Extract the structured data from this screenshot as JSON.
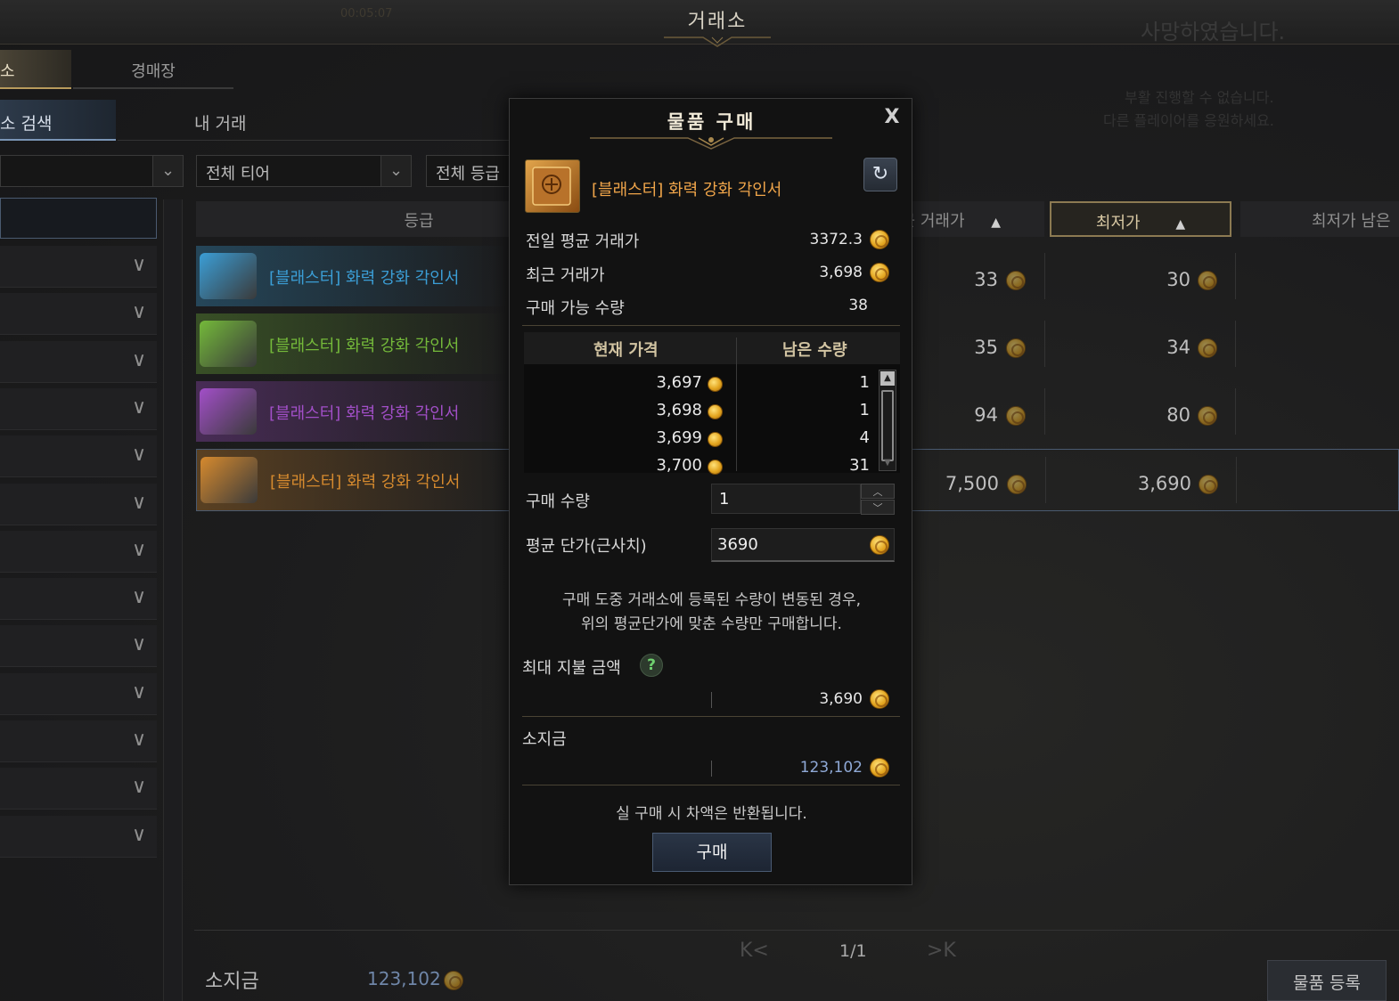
{
  "window": {
    "title": "거래소",
    "timer": "00:05:07",
    "death_title": "사망하였습니다.",
    "death_line1": "부활 진행할 수 없습니다.",
    "death_line2": "다른 플레이어를 응원하세요."
  },
  "main_tabs": [
    {
      "label": "소",
      "active": true
    },
    {
      "label": "경매장",
      "active": false
    }
  ],
  "sub_tabs": [
    {
      "label": "소 검색",
      "active": true
    },
    {
      "label": "내 거래",
      "active": false
    }
  ],
  "filters": {
    "tier": "전체 티어",
    "grade": "전체 등급"
  },
  "table": {
    "headers": {
      "grade": "등급",
      "recent": "최근 거래가",
      "lowest": "최저가",
      "remaining": "최저가 남은"
    },
    "rows": [
      {
        "name": "[블래스터] 화력 강화 각인서",
        "grade": "rare",
        "color": "#3b9ed6",
        "recent": "33",
        "lowest": "30"
      },
      {
        "name": "[블래스터] 화력 강화 각인서",
        "grade": "uncommon",
        "color": "#74b93a",
        "recent": "35",
        "lowest": "34"
      },
      {
        "name": "[블래스터] 화력 강화 각인서",
        "grade": "epic",
        "color": "#a24fc8",
        "recent": "94",
        "lowest": "80"
      },
      {
        "name": "[블래스터] 화력 강화 각인서",
        "grade": "legendary",
        "color": "#d68a2e",
        "recent": "7,500",
        "lowest": "3,690"
      }
    ]
  },
  "footer": {
    "gold_label": "소지금",
    "gold_value": "123,102",
    "pager": "1/1",
    "register_label": "물품 등록"
  },
  "modal": {
    "title": "물품 구매",
    "close": "X",
    "item_name": "[블래스터] 화력 강화 각인서",
    "item_color": "#f0a54a",
    "info": [
      {
        "label": "전일 평균 거래가",
        "value": "3372.3",
        "coin": true
      },
      {
        "label": "최근 거래가",
        "value": "3,698",
        "coin": true
      },
      {
        "label": "구매 가능 수량",
        "value": "38",
        "coin": false
      }
    ],
    "order_book": {
      "price_header": "현재 가격",
      "qty_header": "남은 수량",
      "rows": [
        {
          "price": "3,697",
          "qty": "1"
        },
        {
          "price": "3,698",
          "qty": "1"
        },
        {
          "price": "3,699",
          "qty": "4"
        },
        {
          "price": "3,700",
          "qty": "31"
        }
      ]
    },
    "quantity_label": "구매 수량",
    "quantity_value": "1",
    "avg_price_label": "평균 단가(근사치)",
    "avg_price_value": "3690",
    "notice_line1": "구매 도중 거래소에 등록된 수량이 변동된 경우,",
    "notice_line2": "위의 평균단가에 맞춘 수량만 구매합니다.",
    "max_pay_label": "최대 지불 금액",
    "help_icon": "?",
    "max_pay_value": "3,690",
    "gold_label": "소지금",
    "gold_value": "123,102",
    "refund_notice": "실 구매 시 차액은 반환됩니다.",
    "buy_label": "구매"
  }
}
